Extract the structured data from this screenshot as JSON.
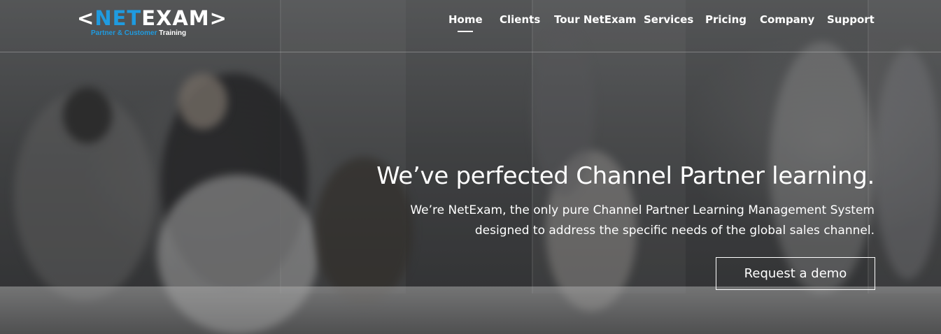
{
  "logo": {
    "prefix": "<",
    "net": "NET",
    "exam": "EXAM",
    "suffix": ">",
    "tagline_colored": "Partner & Customer",
    "tagline_white": "Training"
  },
  "nav": {
    "items": [
      {
        "label": "Home",
        "active": true
      },
      {
        "label": "Clients"
      },
      {
        "label": "Tour NetExam"
      },
      {
        "label": "Services"
      },
      {
        "label": "Pricing"
      },
      {
        "label": "Company"
      },
      {
        "label": "Support"
      }
    ]
  },
  "hero": {
    "headline": "We’ve perfected Channel Partner learning.",
    "sub_line1": "We’re NetExam, the only pure Channel Partner Learning Management System",
    "sub_line2": "designed to address the specific needs of the global sales channel.",
    "cta_label": "Request a demo"
  },
  "colors": {
    "brand_blue": "#1f9be0",
    "text": "#ffffff"
  }
}
